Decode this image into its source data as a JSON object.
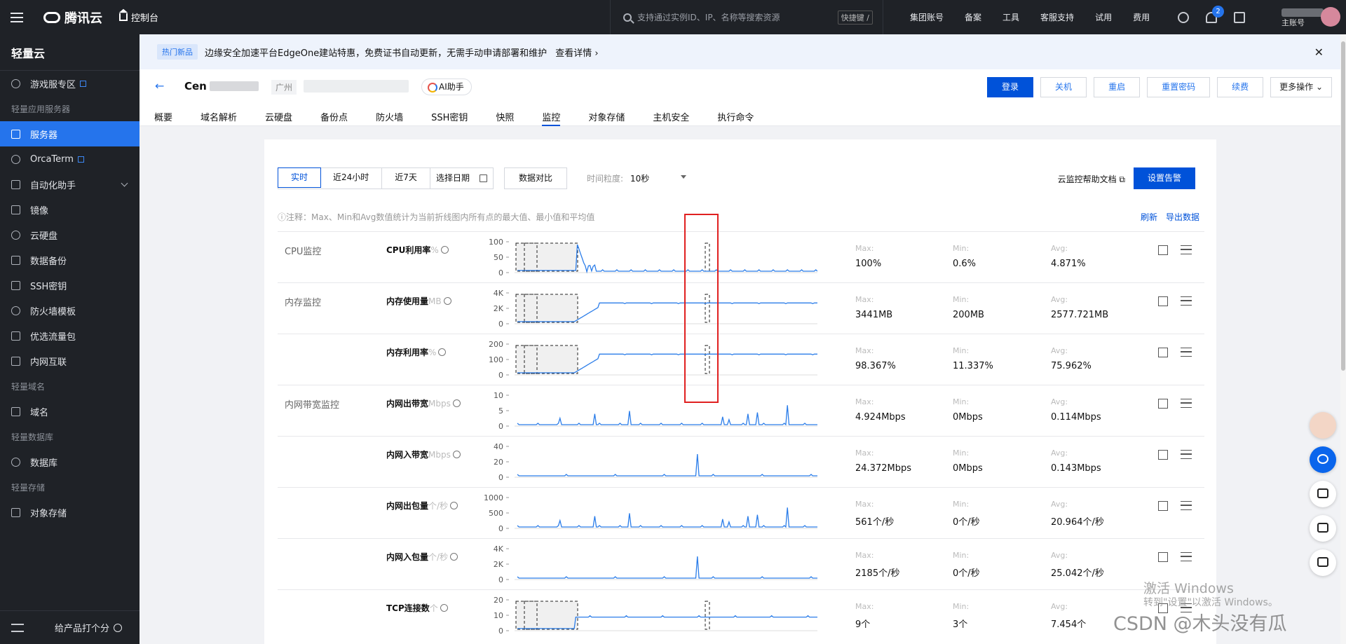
{
  "topbar": {
    "brand": "腾讯云",
    "console": "控制台",
    "search_placeholder": "支持通过实例ID、IP、名称等搜索资源",
    "shortcut": "快捷键 /",
    "nav": [
      "集团账号",
      "备案",
      "工具",
      "客服支持",
      "试用",
      "费用"
    ],
    "notification_count": "2",
    "account_label": "主账号"
  },
  "sidebar": {
    "title": "轻量云",
    "sections": [
      {
        "type": "item",
        "label": "游戏服专区",
        "icon": "gamepad-icon",
        "external": true
      },
      {
        "type": "group",
        "label": "轻量应用服务器"
      },
      {
        "type": "item",
        "label": "服务器",
        "icon": "server-icon",
        "active": true
      },
      {
        "type": "item",
        "label": "OrcaTerm",
        "icon": "terminal-icon",
        "external": true
      },
      {
        "type": "item",
        "label": "自动化助手",
        "icon": "robot-icon",
        "chevron": true
      },
      {
        "type": "item",
        "label": "镜像",
        "icon": "image-icon"
      },
      {
        "type": "item",
        "label": "云硬盘",
        "icon": "disk-icon"
      },
      {
        "type": "item",
        "label": "数据备份",
        "icon": "backup-icon"
      },
      {
        "type": "item",
        "label": "SSH密钥",
        "icon": "key-icon"
      },
      {
        "type": "item",
        "label": "防火墙模板",
        "icon": "shield-icon"
      },
      {
        "type": "item",
        "label": "优选流量包",
        "icon": "traffic-icon"
      },
      {
        "type": "item",
        "label": "内网互联",
        "icon": "network-icon"
      },
      {
        "type": "group",
        "label": "轻量域名"
      },
      {
        "type": "item",
        "label": "域名",
        "icon": "domain-icon"
      },
      {
        "type": "group",
        "label": "轻量数据库"
      },
      {
        "type": "item",
        "label": "数据库",
        "icon": "database-icon"
      },
      {
        "type": "group",
        "label": "轻量存储"
      },
      {
        "type": "item",
        "label": "对象存储",
        "icon": "storage-icon"
      }
    ],
    "bottom_label": "给产品打个分"
  },
  "notice": {
    "tag": "热门新品",
    "text": "边缘安全加速平台EdgeOne建站特惠，免费证书自动更新，无需手动申请部署和维护",
    "more": "查看详情"
  },
  "header": {
    "instance_prefix": "Cen",
    "region": "广州",
    "ai_label": "AI助手",
    "actions": [
      "登录",
      "关机",
      "重启",
      "重置密码",
      "续费"
    ],
    "more_actions": "更多操作",
    "tabs": [
      "概要",
      "域名解析",
      "云硬盘",
      "备份点",
      "防火墙",
      "SSH密钥",
      "快照",
      "监控",
      "对象存储",
      "主机安全",
      "执行命令"
    ],
    "active_tab": "监控"
  },
  "monitor": {
    "ranges": [
      "实时",
      "近24小时",
      "近7天"
    ],
    "active_range": "实时",
    "date_picker": "选择日期",
    "compare": "数据对比",
    "granularity_label": "时间粒度:",
    "granularity_value": "10秒",
    "help_doc": "云监控帮助文档",
    "alarm_button": "设置告警",
    "note": "注释：Max、Min和Avg数值统计为当前折线图内所有点的最大值、最小值和平均值",
    "refresh": "刷新",
    "export": "导出数据",
    "stat_labels": {
      "max": "Max:",
      "min": "Min:",
      "avg": "Avg:"
    },
    "rows": [
      {
        "group": "CPU监控",
        "name": "CPU利用率",
        "unit": "%",
        "ticks": [
          "100",
          "50",
          "0"
        ],
        "max": "100%",
        "min": "0.6%",
        "avg": "4.871%",
        "shape": "cpu"
      },
      {
        "group": "内存监控",
        "name": "内存使用量",
        "unit": "MB",
        "ticks": [
          "4K",
          "2K",
          "0"
        ],
        "max": "3441MB",
        "min": "200MB",
        "avg": "2577.721MB",
        "shape": "mem"
      },
      {
        "group": "",
        "name": "内存利用率",
        "unit": "%",
        "ticks": [
          "200",
          "100",
          "0"
        ],
        "max": "98.367%",
        "min": "11.337%",
        "avg": "75.962%",
        "shape": "mem"
      },
      {
        "group": "内网带宽监控",
        "name": "内网出带宽",
        "unit": "Mbps",
        "ticks": [
          "10",
          "5",
          "0"
        ],
        "max": "4.924Mbps",
        "min": "0Mbps",
        "avg": "0.114Mbps",
        "shape": "spiky"
      },
      {
        "group": "",
        "name": "内网入带宽",
        "unit": "Mbps",
        "ticks": [
          "40",
          "20",
          "0"
        ],
        "max": "24.372Mbps",
        "min": "0Mbps",
        "avg": "0.143Mbps",
        "shape": "onespike"
      },
      {
        "group": "",
        "name": "内网出包量",
        "unit": "个/秒",
        "ticks": [
          "1000",
          "500",
          "0"
        ],
        "max": "561个/秒",
        "min": "0个/秒",
        "avg": "20.964个/秒",
        "shape": "spiky"
      },
      {
        "group": "",
        "name": "内网入包量",
        "unit": "个/秒",
        "ticks": [
          "4K",
          "2K",
          "0"
        ],
        "max": "2185个/秒",
        "min": "0个/秒",
        "avg": "25.042个/秒",
        "shape": "onespike"
      },
      {
        "group": "",
        "name": "TCP连接数",
        "unit": "个",
        "ticks": [
          "20",
          "10",
          "0"
        ],
        "max": "9个",
        "min": "3个",
        "avg": "7.454个",
        "shape": "tcp"
      }
    ]
  },
  "watermark": {
    "line1": "激活 Windows",
    "line2": "转到\"设置\"以激活 Windows。",
    "csdn": "CSDN @木头没有瓜"
  },
  "colors": {
    "accent": "#0052d9",
    "line": "#2b7de9",
    "highlight_box": "#e02020"
  }
}
